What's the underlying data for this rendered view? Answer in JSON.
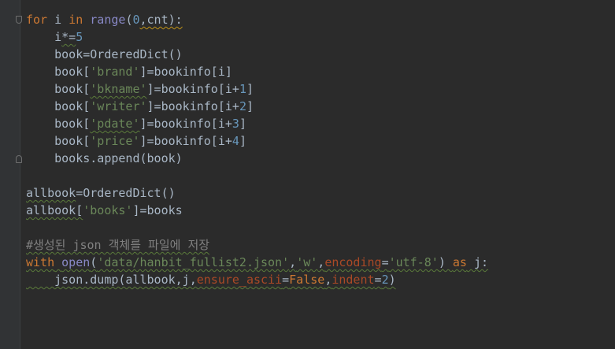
{
  "colors": {
    "background": "#2b2b2b",
    "keyword": "#cc7832",
    "builtin": "#8888c6",
    "number": "#6897bb",
    "string": "#6a8759",
    "comment": "#808080",
    "named_param": "#aa4926",
    "default_text": "#a9b7c6"
  },
  "code": {
    "l1": {
      "kw_for": "for",
      "t1": " i ",
      "kw_in": "in",
      "t2": " ",
      "fn_range": "range",
      "t3": "(",
      "n0": "0",
      "t4": ",cnt):"
    },
    "l2": {
      "t1": "    i",
      "t2": "*=",
      "n5": "5"
    },
    "l3": {
      "t1": "    book",
      "t2": "=OrderedDict()"
    },
    "l4": {
      "t1": "    book[",
      "s": "'brand'",
      "t2": "]=bookinfo[i]"
    },
    "l5": {
      "t1": "    book[",
      "s": "'bkname'",
      "t2": "]=bookinfo[i+",
      "n": "1",
      "t3": "]"
    },
    "l6": {
      "t1": "    book[",
      "s": "'writer'",
      "t2": "]=bookinfo[i+",
      "n": "2",
      "t3": "]"
    },
    "l7": {
      "t1": "    book[",
      "s": "'pdate'",
      "t2": "]=bookinfo[i+",
      "n": "3",
      "t3": "]"
    },
    "l8": {
      "t1": "    book[",
      "s": "'price'",
      "t2": "]=bookinfo[i+",
      "n": "4",
      "t3": "]"
    },
    "l9": {
      "t1": "    books.append(book)"
    },
    "l11": {
      "t1": "allbook",
      "t2": "=OrderedDict()"
    },
    "l12": {
      "t1": "allbook[",
      "s": "'books'",
      "t2": "]=books"
    },
    "l14": {
      "c": "#생성된 json 객체를 파일에 저장"
    },
    "l15": {
      "kw_with": "with",
      "t1": " ",
      "fn_open": "open",
      "t2": "(",
      "s1": "'data/hanbit_fullist2.json'",
      "t3": ",",
      "s2": "'w'",
      "t4": ",",
      "p": "encoding",
      "t5": "=",
      "s3": "'utf-8'",
      "t6": ") ",
      "kw_as": "as",
      "t7": " j:"
    },
    "l16": {
      "t1": "    json.dump(allbook,j,",
      "p1": "ensure_ascii",
      "t2": "=",
      "kw_false": "False",
      "t3": ",",
      "p2": "indent",
      "t4": "=",
      "n": "2",
      "t5": ")"
    }
  }
}
